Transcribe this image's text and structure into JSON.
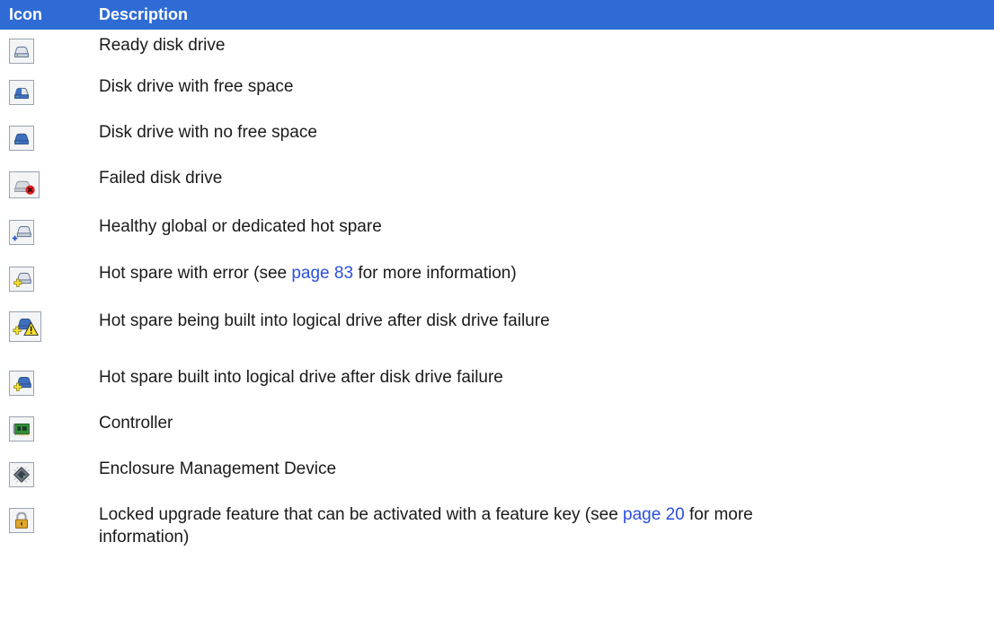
{
  "header": {
    "col_icon": "Icon",
    "col_description": "Description"
  },
  "rows": [
    {
      "icon": "ready-disk-drive-icon",
      "text": "Ready disk drive"
    },
    {
      "icon": "disk-free-space-icon",
      "text": "Disk drive with free space"
    },
    {
      "icon": "disk-no-free-space-icon",
      "text": "Disk drive with no free space"
    },
    {
      "icon": "failed-disk-drive-icon",
      "text": "Failed disk drive"
    },
    {
      "icon": "healthy-hot-spare-icon",
      "text": "Healthy global or dedicated hot spare"
    },
    {
      "icon": "hot-spare-error-icon",
      "text_before": "Hot spare with error (see ",
      "link": "page 83",
      "text_after": " for more information)"
    },
    {
      "icon": "hot-spare-building-icon",
      "text": "Hot spare being built into logical drive after disk drive failure"
    },
    {
      "icon": "hot-spare-built-icon",
      "text": "Hot spare built into logical drive after disk drive failure"
    },
    {
      "icon": "controller-icon",
      "text": "Controller"
    },
    {
      "icon": "enclosure-management-device-icon",
      "text": "Enclosure Management Device"
    },
    {
      "icon": "lock-icon",
      "text_before": "Locked upgrade feature that can be activated with a feature key (see ",
      "link": "page 20",
      "text_after": " for more",
      "text_line2": "information)"
    }
  ],
  "colors": {
    "header_bg": "#2f6bd5",
    "link": "#2a4fe0"
  }
}
